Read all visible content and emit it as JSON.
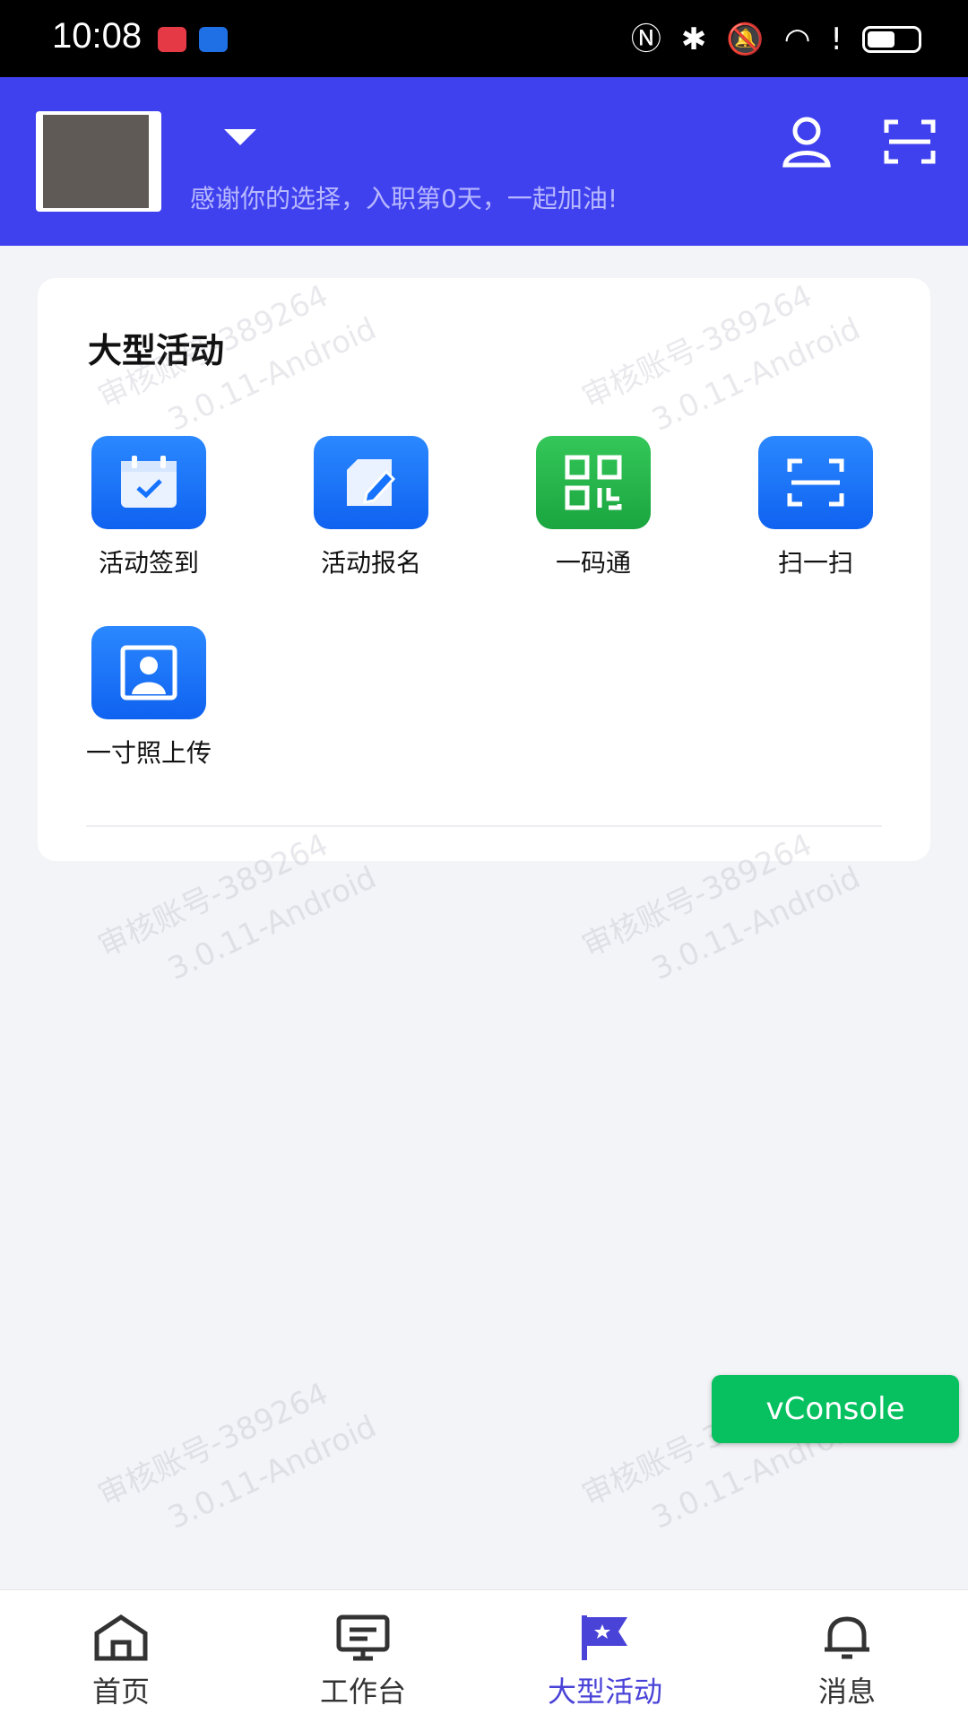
{
  "status_bar": {
    "time": "10:08"
  },
  "header": {
    "greeting": "感谢你的选择，入职第0天，一起加油!"
  },
  "card": {
    "title": "大型活动",
    "items": [
      {
        "label": "活动签到",
        "icon": "calendar-check-icon",
        "color": "#1673ff"
      },
      {
        "label": "活动报名",
        "icon": "edit-form-icon",
        "color": "#1673ff"
      },
      {
        "label": "一码通",
        "icon": "qr-code-icon",
        "color": "#22b84b"
      },
      {
        "label": "扫一扫",
        "icon": "scan-icon",
        "color": "#1673ff"
      },
      {
        "label": "一寸照上传",
        "icon": "id-photo-icon",
        "color": "#1673ff"
      }
    ]
  },
  "watermark": {
    "line1": "审核账号-389264",
    "line2": "3.0.11-Android"
  },
  "vconsole_label": "vConsole",
  "tabs": [
    {
      "label": "首页",
      "icon": "home-icon",
      "active": false
    },
    {
      "label": "工作台",
      "icon": "monitor-icon",
      "active": false
    },
    {
      "label": "大型活动",
      "icon": "flag-icon",
      "active": true
    },
    {
      "label": "消息",
      "icon": "bell-icon",
      "active": false
    }
  ],
  "colors": {
    "header": "#4041ee",
    "accent": "#4a43d8",
    "vconsole": "#07c160"
  }
}
